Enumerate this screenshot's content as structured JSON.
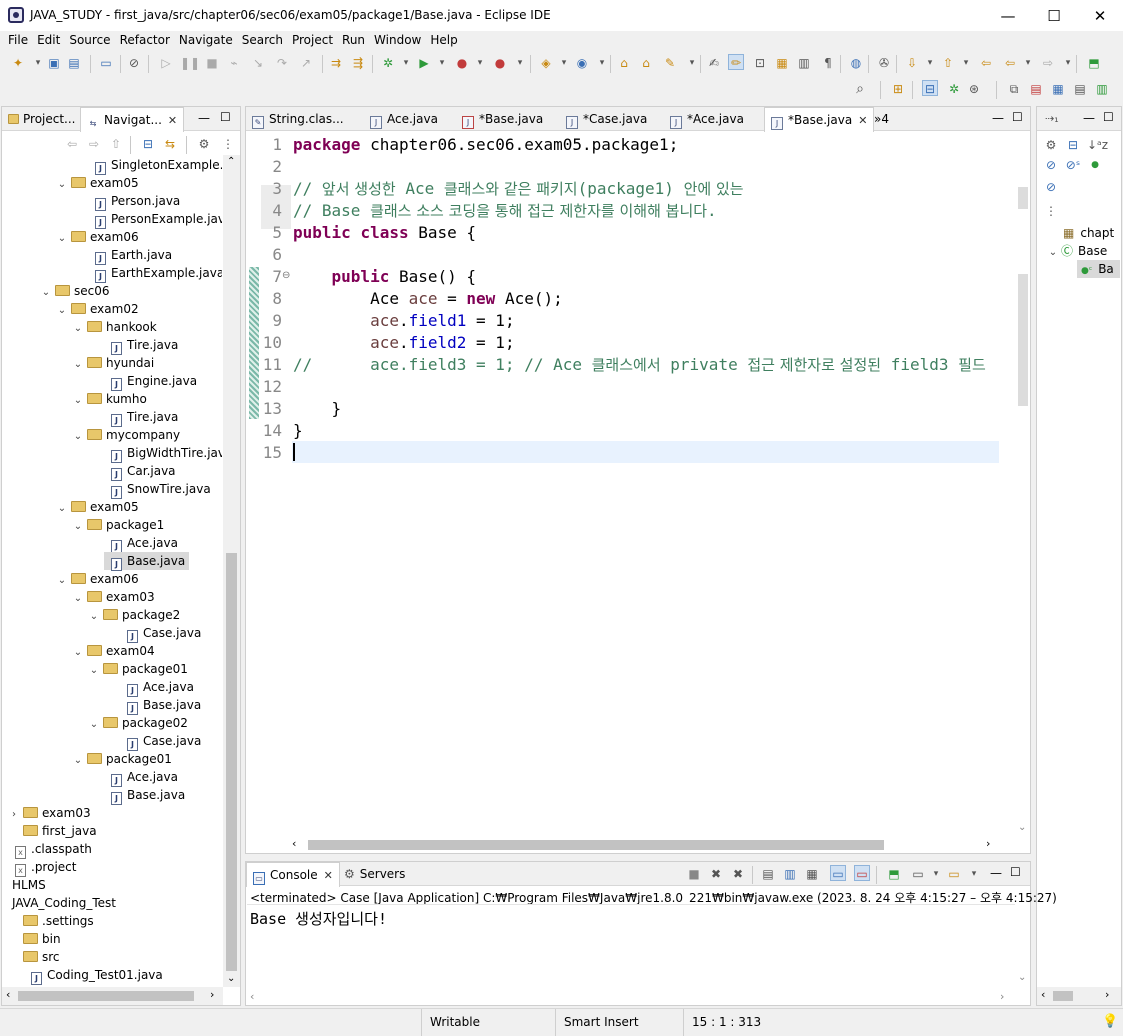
{
  "window": {
    "title": "JAVA_STUDY - first_java/src/chapter06/sec06/exam05/package1/Base.java - Eclipse IDE",
    "minimize": "—",
    "maximize": "☐",
    "close": "✕"
  },
  "menu": [
    "File",
    "Edit",
    "Source",
    "Refactor",
    "Navigate",
    "Search",
    "Project",
    "Run",
    "Window",
    "Help"
  ],
  "left_panel": {
    "tabs": [
      "Project...",
      "Navigat..."
    ],
    "tree": [
      {
        "label": "SingletonExample.java",
        "type": "java",
        "indent": 5,
        "twisty": ""
      },
      {
        "label": "exam05",
        "type": "folder",
        "indent": 3,
        "twisty": "⌄"
      },
      {
        "label": "Person.java",
        "type": "java",
        "indent": 5,
        "twisty": ""
      },
      {
        "label": "PersonExample.java",
        "type": "java",
        "indent": 5,
        "twisty": ""
      },
      {
        "label": "exam06",
        "type": "folder",
        "indent": 3,
        "twisty": "⌄"
      },
      {
        "label": "Earth.java",
        "type": "java",
        "indent": 5,
        "twisty": ""
      },
      {
        "label": "EarthExample.java",
        "type": "java",
        "indent": 5,
        "twisty": ""
      },
      {
        "label": "sec06",
        "type": "folder",
        "indent": 2,
        "twisty": "⌄"
      },
      {
        "label": "exam02",
        "type": "folder",
        "indent": 3,
        "twisty": "⌄"
      },
      {
        "label": "hankook",
        "type": "folder",
        "indent": 4,
        "twisty": "⌄"
      },
      {
        "label": "Tire.java",
        "type": "java",
        "indent": 6,
        "twisty": ""
      },
      {
        "label": "hyundai",
        "type": "folder",
        "indent": 4,
        "twisty": "⌄"
      },
      {
        "label": "Engine.java",
        "type": "java",
        "indent": 6,
        "twisty": ""
      },
      {
        "label": "kumho",
        "type": "folder",
        "indent": 4,
        "twisty": "⌄"
      },
      {
        "label": "Tire.java",
        "type": "java",
        "indent": 6,
        "twisty": ""
      },
      {
        "label": "mycompany",
        "type": "folder",
        "indent": 4,
        "twisty": "⌄"
      },
      {
        "label": "BigWidthTire.java",
        "type": "java",
        "indent": 6,
        "twisty": ""
      },
      {
        "label": "Car.java",
        "type": "java",
        "indent": 6,
        "twisty": ""
      },
      {
        "label": "SnowTire.java",
        "type": "java",
        "indent": 6,
        "twisty": ""
      },
      {
        "label": "exam05",
        "type": "folder",
        "indent": 3,
        "twisty": "⌄"
      },
      {
        "label": "package1",
        "type": "folder",
        "indent": 4,
        "twisty": "⌄"
      },
      {
        "label": "Ace.java",
        "type": "java",
        "indent": 6,
        "twisty": ""
      },
      {
        "label": "Base.java",
        "type": "java",
        "indent": 6,
        "twisty": "",
        "selected": true
      },
      {
        "label": "exam06",
        "type": "folder",
        "indent": 3,
        "twisty": "⌄"
      },
      {
        "label": "exam03",
        "type": "folder",
        "indent": 4,
        "twisty": "⌄"
      },
      {
        "label": "package2",
        "type": "folder",
        "indent": 5,
        "twisty": "⌄"
      },
      {
        "label": "Case.java",
        "type": "java",
        "indent": 7,
        "twisty": ""
      },
      {
        "label": "exam04",
        "type": "folder",
        "indent": 4,
        "twisty": "⌄"
      },
      {
        "label": "package01",
        "type": "folder",
        "indent": 5,
        "twisty": "⌄"
      },
      {
        "label": "Ace.java",
        "type": "java",
        "indent": 7,
        "twisty": ""
      },
      {
        "label": "Base.java",
        "type": "java",
        "indent": 7,
        "twisty": ""
      },
      {
        "label": "package02",
        "type": "folder",
        "indent": 5,
        "twisty": "⌄"
      },
      {
        "label": "Case.java",
        "type": "java",
        "indent": 7,
        "twisty": ""
      },
      {
        "label": "package01",
        "type": "folder",
        "indent": 4,
        "twisty": "⌄"
      },
      {
        "label": "Ace.java",
        "type": "java",
        "indent": 6,
        "twisty": ""
      },
      {
        "label": "Base.java",
        "type": "java",
        "indent": 6,
        "twisty": ""
      },
      {
        "label": "exam03",
        "type": "folder",
        "indent": 0,
        "twisty": "›"
      },
      {
        "label": "first_java",
        "type": "folder",
        "indent": 0,
        "twisty": ""
      },
      {
        "label": ".classpath",
        "type": "x",
        "indent": 0,
        "twisty": ""
      },
      {
        "label": ".project",
        "type": "x",
        "indent": 0,
        "twisty": ""
      },
      {
        "label": "HLMS",
        "type": "text",
        "indent": 0,
        "twisty": ""
      },
      {
        "label": "JAVA_Coding_Test",
        "type": "text",
        "indent": 0,
        "twisty": ""
      },
      {
        "label": ".settings",
        "type": "folder",
        "indent": 0,
        "twisty": ""
      },
      {
        "label": "bin",
        "type": "folder",
        "indent": 0,
        "twisty": ""
      },
      {
        "label": "src",
        "type": "folder",
        "indent": 0,
        "twisty": ""
      },
      {
        "label": "Coding_Test01.java",
        "type": "java",
        "indent": 1,
        "twisty": ""
      }
    ]
  },
  "editor": {
    "tabs": [
      {
        "label": "String.clas...",
        "active": false
      },
      {
        "label": "Ace.java",
        "active": false
      },
      {
        "label": "*Base.java",
        "active": false
      },
      {
        "label": "*Case.java",
        "active": false
      },
      {
        "label": "*Ace.java",
        "active": false
      },
      {
        "label": "*Base.java",
        "active": true
      }
    ],
    "overflow": "»4",
    "lines": [
      {
        "n": "1",
        "html": "<span class='kw'>package</span> chapter06.sec06.exam05.package1;"
      },
      {
        "n": "2",
        "html": ""
      },
      {
        "n": "3",
        "html": "<span class='cm'>// <span class='cm-ko'>앞서 생성한</span> Ace <span class='cm-ko'>클래스와 같은 패키지</span>(package1) <span class='cm-ko'>안에 있는</span></span>"
      },
      {
        "n": "4",
        "html": "<span class='cm'>// Base <span class='cm-ko'>클래스 소스 코딩을 통해 접근 제한자를 이해해 봅니다</span>.</span>"
      },
      {
        "n": "5",
        "html": "<span class='kw'>public</span> <span class='kw'>class</span> Base {"
      },
      {
        "n": "6",
        "html": ""
      },
      {
        "n": "7",
        "html": "    <span class='kw'>public</span> Base() {"
      },
      {
        "n": "8",
        "html": "        Ace <span class='fld' style='color:#6a3e3e'>ace</span> = <span class='kw'>new</span> Ace();"
      },
      {
        "n": "9",
        "html": "        <span style='color:#6a3e3e'>ace</span>.<span class='fld'>field1</span> = 1;"
      },
      {
        "n": "10",
        "html": "        <span style='color:#6a3e3e'>ace</span>.<span class='fld'>field2</span> = 1;"
      },
      {
        "n": "11",
        "html": "<span class='cm'>//      ace.field3 = 1; // Ace <span class='cm-ko'>클래스에서</span> private <span class='cm-ko'>접근 제한자로 설정된</span> field3 <span class='cm-ko'>필드</span></span>"
      },
      {
        "n": "12",
        "html": ""
      },
      {
        "n": "13",
        "html": "    }"
      },
      {
        "n": "14",
        "html": "}"
      },
      {
        "n": "15",
        "html": ""
      }
    ]
  },
  "outline": {
    "items": [
      "chapt",
      "Base",
      "Ba"
    ]
  },
  "console": {
    "tabs": [
      "Console",
      "Servers"
    ],
    "status": "<terminated> Case [Java Application] C:₩Program Files₩Java₩jre1.8.0_221₩bin₩javaw.exe  (2023. 8. 24 오후 4:15:27 – 오후 4:15:27)",
    "output": "Base 생성자입니다!"
  },
  "statusbar": {
    "writable": "Writable",
    "insert_mode": "Smart Insert",
    "position": "15 : 1 : 313"
  }
}
